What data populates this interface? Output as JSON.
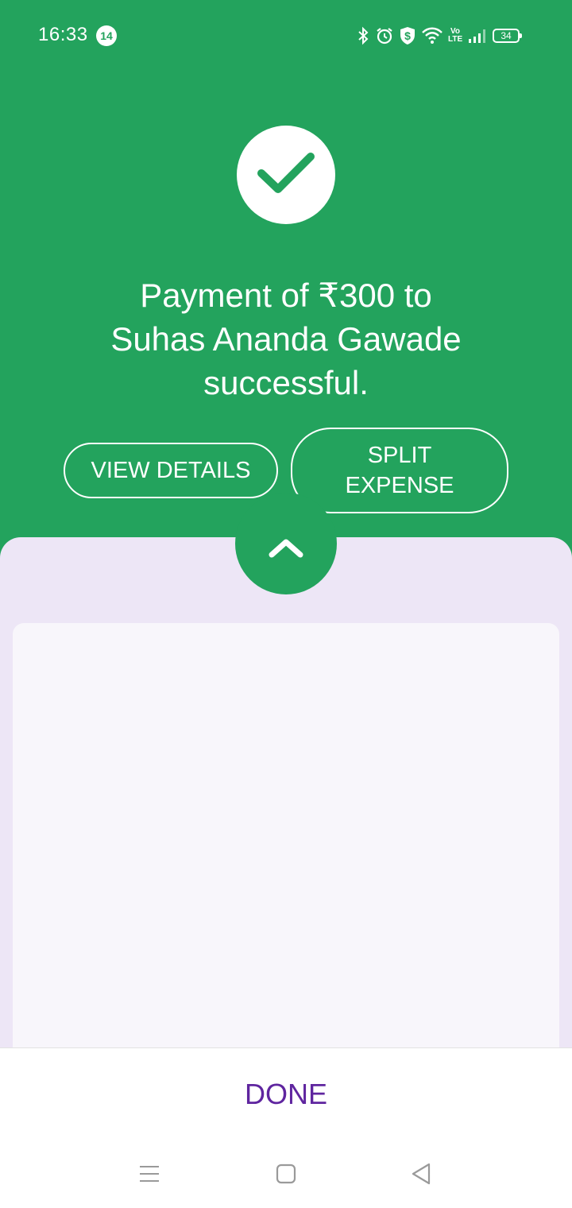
{
  "status_bar": {
    "time": "16:33",
    "notification_count": "14",
    "battery_level": "34",
    "network_label": "Vo LTE"
  },
  "payment": {
    "message_line1": "Payment of ₹300 to",
    "message_line2": "Suhas Ananda Gawade",
    "message_line3": "successful.",
    "view_details_label": "VIEW DETAILS",
    "split_expense_label": "SPLIT EXPENSE"
  },
  "footer": {
    "done_label": "DONE"
  },
  "colors": {
    "success_green": "#23a35d",
    "brand_purple": "#5f259f",
    "sheet_lavender": "#ede6f6",
    "card_background": "#f8f6fb"
  },
  "icons": {
    "status": [
      "bluetooth-icon",
      "alarm-icon",
      "shield-dollar-icon",
      "wifi-icon",
      "volte-icon",
      "signal-icon",
      "battery-icon"
    ],
    "main": [
      "checkmark-icon",
      "chevron-up-icon"
    ],
    "navigation": [
      "menu-icon",
      "home-icon",
      "back-icon"
    ]
  }
}
